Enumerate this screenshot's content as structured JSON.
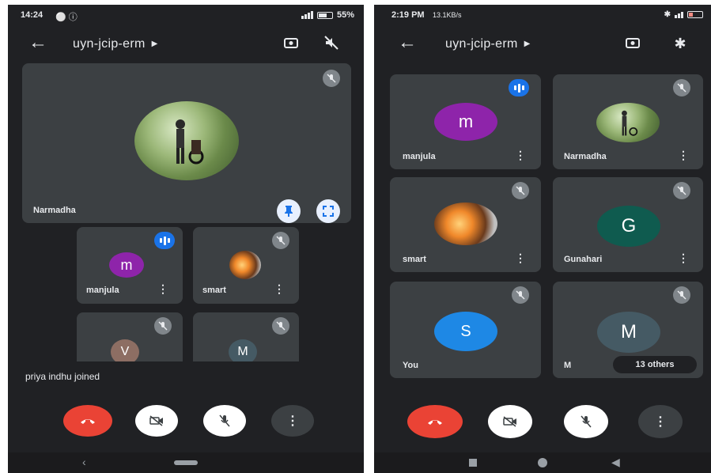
{
  "left_screen": {
    "status": {
      "time": "14:24",
      "battery": "55%"
    },
    "meeting_code": "uyn-jcip-erm",
    "main_tile": {
      "name": "Narmadha"
    },
    "tiles": [
      {
        "initial": "m",
        "name": "manjula",
        "color": "#8e24aa"
      },
      {
        "initial": "",
        "name": "smart",
        "color": ""
      },
      {
        "initial": "V",
        "name": "",
        "color": "#8d6e63"
      },
      {
        "initial": "M",
        "name": "",
        "color": "#455a64"
      }
    ],
    "toast": "priya indhu joined"
  },
  "right_screen": {
    "status": {
      "time": "2:19 PM",
      "speed": "13.1KB/s"
    },
    "meeting_code": "uyn-jcip-erm",
    "tiles": [
      {
        "initial": "m",
        "name": "manjula",
        "color": "#8e24aa"
      },
      {
        "initial": "",
        "name": "Narmadha",
        "color": ""
      },
      {
        "initial": "",
        "name": "smart",
        "color": ""
      },
      {
        "initial": "G",
        "name": "Gunahari",
        "color": "#0f5b4f"
      },
      {
        "initial": "S",
        "name": "You",
        "color": "#1e88e5"
      },
      {
        "initial": "M",
        "name": "M",
        "color": "#455a64"
      }
    ],
    "others_label": "13 others"
  },
  "colors": {
    "end_call": "#ea4335",
    "accent": "#1a73e8",
    "background": "#202124",
    "tile": "#3c4043"
  },
  "icons": [
    "back-arrow-icon",
    "caret-right-icon",
    "switch-camera-icon",
    "audio-off-icon",
    "bluetooth-icon",
    "mic-off-icon",
    "speaking-icon",
    "pin-icon",
    "fullscreen-icon",
    "more-vert-icon",
    "end-call-icon",
    "camera-off-icon"
  ]
}
